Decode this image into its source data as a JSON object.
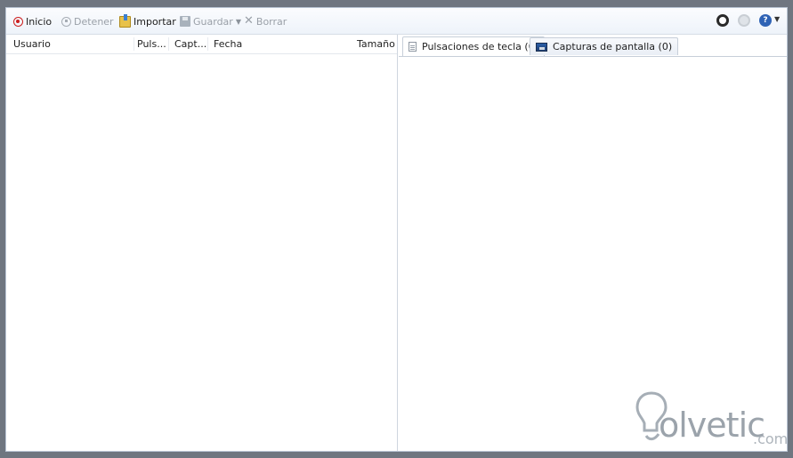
{
  "toolbar": {
    "start_label": "Inicio",
    "stop_label": "Detener",
    "import_label": "Importar",
    "save_label": "Guardar",
    "delete_label": "Borrar"
  },
  "list": {
    "columns": [
      "Usuario",
      "Puls...",
      "Capt...",
      "Fecha",
      "Tamaño"
    ]
  },
  "tabs": [
    {
      "label": "Pulsaciones de tecla (0)",
      "icon": "document-icon",
      "active": true
    },
    {
      "label": "Capturas de pantalla (0)",
      "icon": "screenshot-icon",
      "active": false
    }
  ],
  "watermark": {
    "text": "olvetic",
    "suffix": ".com"
  },
  "colors": {
    "record_red": "#cc1f1f",
    "help_blue": "#2f63b5",
    "disabled_text": "#9aa0a8"
  }
}
